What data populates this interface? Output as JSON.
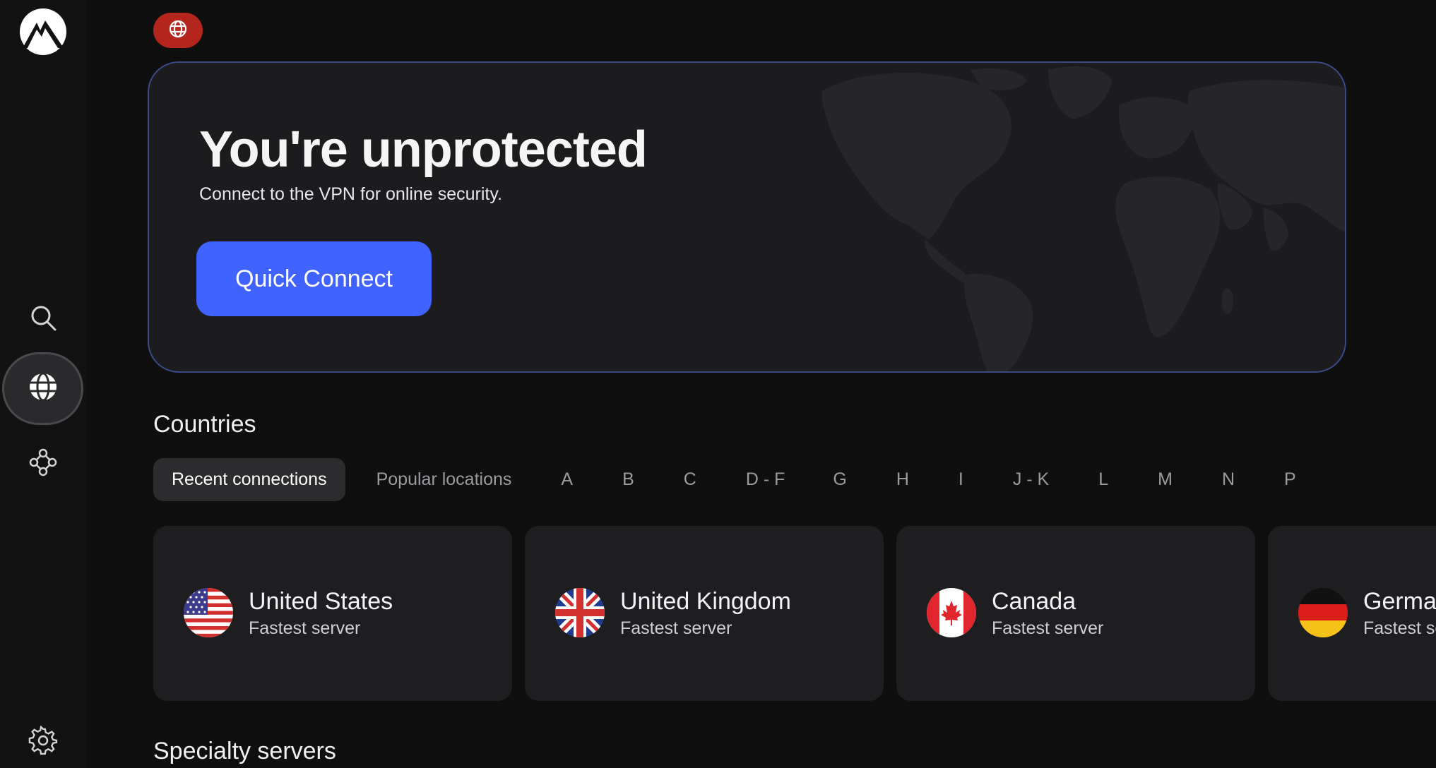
{
  "sidebar": {
    "logo_icon": "mountain-logo-icon",
    "items": [
      {
        "name": "search",
        "icon": "search-icon"
      },
      {
        "name": "countries",
        "icon": "globe-icon",
        "active": true
      },
      {
        "name": "meshnet",
        "icon": "meshnet-icon"
      },
      {
        "name": "settings",
        "icon": "gear-icon"
      }
    ]
  },
  "status": {
    "icon": "globe-icon",
    "color": "#b3251d"
  },
  "hero": {
    "title": "You're unprotected",
    "subtitle": "Connect to the VPN for online security.",
    "button_label": "Quick Connect",
    "button_color": "#4062ff"
  },
  "countries": {
    "title": "Countries",
    "tabs": [
      {
        "label": "Recent connections",
        "active": true
      },
      {
        "label": "Popular locations"
      },
      {
        "label": "A"
      },
      {
        "label": "B"
      },
      {
        "label": "C"
      },
      {
        "label": "D - F"
      },
      {
        "label": "G"
      },
      {
        "label": "H"
      },
      {
        "label": "I"
      },
      {
        "label": "J - K"
      },
      {
        "label": "L"
      },
      {
        "label": "M"
      },
      {
        "label": "N"
      },
      {
        "label": "P"
      }
    ],
    "cards": [
      {
        "name": "United States",
        "sub": "Fastest server",
        "flag": "us-flag-icon"
      },
      {
        "name": "United Kingdom",
        "sub": "Fastest server",
        "flag": "uk-flag-icon"
      },
      {
        "name": "Canada",
        "sub": "Fastest server",
        "flag": "canada-flag-icon"
      },
      {
        "name": "Germany",
        "sub": "Fastest server",
        "flag": "germany-flag-icon"
      }
    ]
  },
  "specialty": {
    "title": "Specialty servers"
  }
}
